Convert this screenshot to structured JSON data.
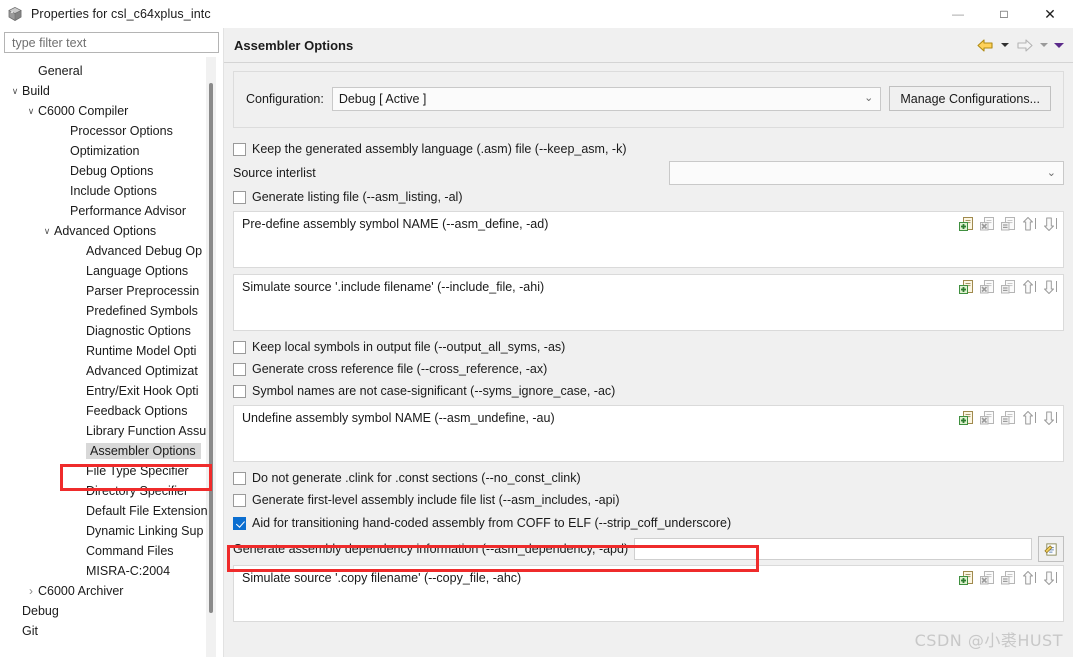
{
  "window": {
    "title": "Properties for csl_c64xplus_intc",
    "icon": "cube-icon",
    "controls": {
      "minimize": "—",
      "maximize": "□",
      "close": "✕"
    }
  },
  "sidebar": {
    "filter": {
      "value": "",
      "placeholder": "type filter text"
    },
    "items": [
      {
        "label": "General",
        "indent": 1,
        "twisty": "",
        "selected": false
      },
      {
        "label": "Build",
        "indent": 0,
        "twisty": "v",
        "selected": false
      },
      {
        "label": "C6000 Compiler",
        "indent": 1,
        "twisty": "v",
        "selected": false
      },
      {
        "label": "Processor Options",
        "indent": 3,
        "twisty": "",
        "selected": false
      },
      {
        "label": "Optimization",
        "indent": 3,
        "twisty": "",
        "selected": false
      },
      {
        "label": "Debug Options",
        "indent": 3,
        "twisty": "",
        "selected": false
      },
      {
        "label": "Include Options",
        "indent": 3,
        "twisty": "",
        "selected": false
      },
      {
        "label": "Performance Advisor",
        "indent": 3,
        "twisty": "",
        "selected": false
      },
      {
        "label": "Advanced Options",
        "indent": 2,
        "twisty": "v",
        "selected": false
      },
      {
        "label": "Advanced Debug Op",
        "indent": 4,
        "twisty": "",
        "selected": false
      },
      {
        "label": "Language Options",
        "indent": 4,
        "twisty": "",
        "selected": false
      },
      {
        "label": "Parser Preprocessin",
        "indent": 4,
        "twisty": "",
        "selected": false
      },
      {
        "label": "Predefined Symbols",
        "indent": 4,
        "twisty": "",
        "selected": false
      },
      {
        "label": "Diagnostic Options",
        "indent": 4,
        "twisty": "",
        "selected": false
      },
      {
        "label": "Runtime Model Opti",
        "indent": 4,
        "twisty": "",
        "selected": false
      },
      {
        "label": "Advanced Optimizat",
        "indent": 4,
        "twisty": "",
        "selected": false
      },
      {
        "label": "Entry/Exit Hook Opti",
        "indent": 4,
        "twisty": "",
        "selected": false
      },
      {
        "label": "Feedback Options",
        "indent": 4,
        "twisty": "",
        "selected": false
      },
      {
        "label": "Library Function Assu",
        "indent": 4,
        "twisty": "",
        "selected": false
      },
      {
        "label": "Assembler Options",
        "indent": 4,
        "twisty": "",
        "selected": true
      },
      {
        "label": "File Type Specifier",
        "indent": 4,
        "twisty": "",
        "selected": false
      },
      {
        "label": "Directory Specifier",
        "indent": 4,
        "twisty": "",
        "selected": false
      },
      {
        "label": "Default File Extension",
        "indent": 4,
        "twisty": "",
        "selected": false
      },
      {
        "label": "Dynamic Linking Sup",
        "indent": 4,
        "twisty": "",
        "selected": false
      },
      {
        "label": "Command Files",
        "indent": 4,
        "twisty": "",
        "selected": false
      },
      {
        "label": "MISRA-C:2004",
        "indent": 4,
        "twisty": "",
        "selected": false
      },
      {
        "label": "C6000 Archiver",
        "indent": 1,
        "twisty": ">",
        "selected": false
      },
      {
        "label": "Debug",
        "indent": 0,
        "twisty": "",
        "selected": false
      },
      {
        "label": "Git",
        "indent": 0,
        "twisty": "",
        "selected": false
      }
    ]
  },
  "panel": {
    "title": "Assembler Options",
    "nav": {
      "back_icon": "back-arrow-icon",
      "back_dropdown_icon": "chevron-down-icon",
      "forward_icon": "forward-arrow-icon",
      "forward_dropdown_icon": "chevron-down-icon",
      "menu_dropdown_icon": "chevron-down-icon"
    },
    "configuration": {
      "label": "Configuration:",
      "value": "Debug  [ Active ]",
      "chevron": "⌄",
      "manage_button": "Manage Configurations..."
    },
    "keep_asm": {
      "label": "Keep the generated assembly language (.asm) file (--keep_asm, -k)",
      "checked": false
    },
    "source_interlist": {
      "label": "Source interlist",
      "value": "",
      "chevron": "⌄"
    },
    "asm_listing": {
      "label": "Generate listing file (--asm_listing, -al)",
      "checked": false
    },
    "lists": [
      {
        "title": "Pre-define assembly symbol NAME (--asm_define, -ad)",
        "items": []
      },
      {
        "title": "Simulate source '.include filename' (--include_file, -ahi)",
        "items": []
      }
    ],
    "mid_checkboxes": [
      {
        "label": "Keep local symbols in output file (--output_all_syms, -as)",
        "checked": false
      },
      {
        "label": "Generate cross reference file (--cross_reference, -ax)",
        "checked": false
      },
      {
        "label": "Symbol names are not case-significant (--syms_ignore_case, -ac)",
        "checked": false
      }
    ],
    "undefine_list": {
      "title": "Undefine assembly symbol NAME (--asm_undefine, -au)",
      "items": []
    },
    "lower_checkboxes": [
      {
        "label": "Do not generate .clink for .const sections (--no_const_clink)",
        "checked": false
      },
      {
        "label": "Generate first-level assembly include file list (--asm_includes, -api)",
        "checked": false
      },
      {
        "label": "Aid for transitioning hand-coded assembly from COFF to ELF (--strip_coff_underscore)",
        "checked": true,
        "highlighted": true
      }
    ],
    "dependency": {
      "label": "Generate assembly dependency information (--asm_dependency, -apd)",
      "value": "",
      "browse_icon": "edit-file-icon"
    },
    "copy_list": {
      "title": "Simulate source '.copy filename' (--copy_file, -ahc)",
      "items": []
    },
    "list_toolbar_icons": [
      "add-item-icon",
      "delete-item-icon",
      "edit-item-icon",
      "move-up-icon",
      "move-down-icon"
    ]
  },
  "watermark": "CSDN @小裘HUST",
  "colors": {
    "highlight_red": "#ef2b2b",
    "checkbox_blue": "#0b6ed0",
    "panel_bg": "#f0f0f0",
    "selection_gray": "#d8d8d8"
  }
}
